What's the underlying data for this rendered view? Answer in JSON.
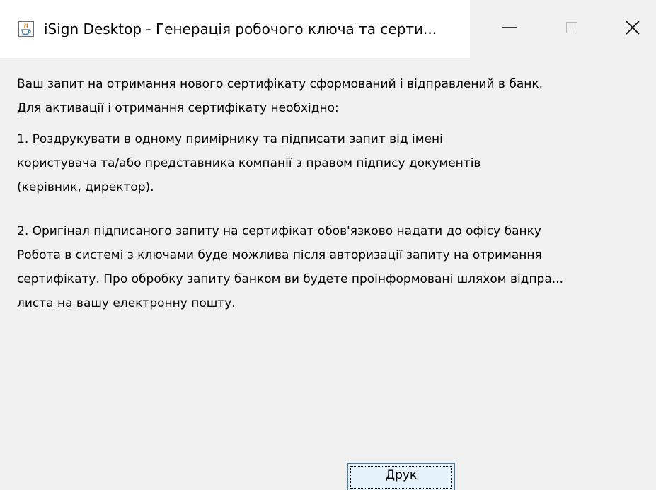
{
  "window": {
    "title": "iSign Desktop - Генерація робочого ключа та серти...",
    "app_icon": "java-cup-icon",
    "controls": {
      "minimize_icon": "minimize-icon",
      "maximize_icon": "maximize-icon",
      "close_icon": "close-icon"
    }
  },
  "message": {
    "paragraph_1": [
      "Ваш запит на отримання нового сертифікату сформований і відправлений в банк.",
      "Для активації і отримання сертифікату необхідно:"
    ],
    "paragraph_2": [
      "1. Роздрукувати в одному примірнику та підписати запит від імені",
      "користувача та/або представника компанії з правом підпису документів",
      "(керівник, директор)."
    ],
    "paragraph_3": [
      "2. Оригінал підписаного запиту на сертифікат обов'язково надати до офісу банку",
      "Робота в системі з ключами буде можлива після авторизації запиту на отримання",
      "сертифікату. Про обробку запиту банком ви будете проінформовані шляхом відпра...",
      "листа на вашу електронну пошту."
    ]
  },
  "buttons": {
    "print_label": "Друк"
  },
  "colors": {
    "titlebar_bg": "#ffffff",
    "window_bg": "#f0f0f0",
    "button_bg": "#e5f1fb",
    "button_border": "#3c7fb1"
  }
}
